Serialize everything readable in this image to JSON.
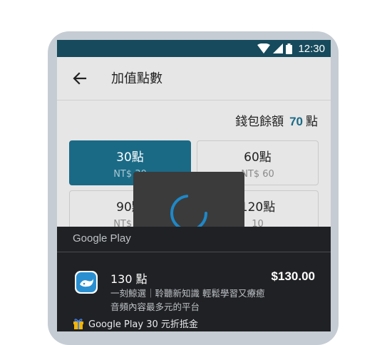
{
  "status_bar": {
    "time": "12:30"
  },
  "app_bar": {
    "title": "加值點數"
  },
  "wallet": {
    "label": "錢包餘額",
    "amount": "70",
    "unit": "點"
  },
  "packages": [
    {
      "points": "30點",
      "price": "NT$ 30",
      "selected": true
    },
    {
      "points": "60點",
      "price": "NT$ 60",
      "selected": false
    },
    {
      "points": "90點",
      "price": "NT$ 90",
      "selected": false
    },
    {
      "points": "120點",
      "price": "10",
      "selected": false
    }
  ],
  "google_play": {
    "brand": "Google Play",
    "product_name": "130 點",
    "price": "$130.00",
    "description": "一刻鯨選｜聆聽新知識 輕鬆學習又療癒 音頻內容最多元的平台",
    "promo": "Google Play 30 元折抵金"
  },
  "colors": {
    "accent": "#1a6a86",
    "status_bar": "#164a5c",
    "sheet": "#202124",
    "spinner": "#1e88c8"
  }
}
